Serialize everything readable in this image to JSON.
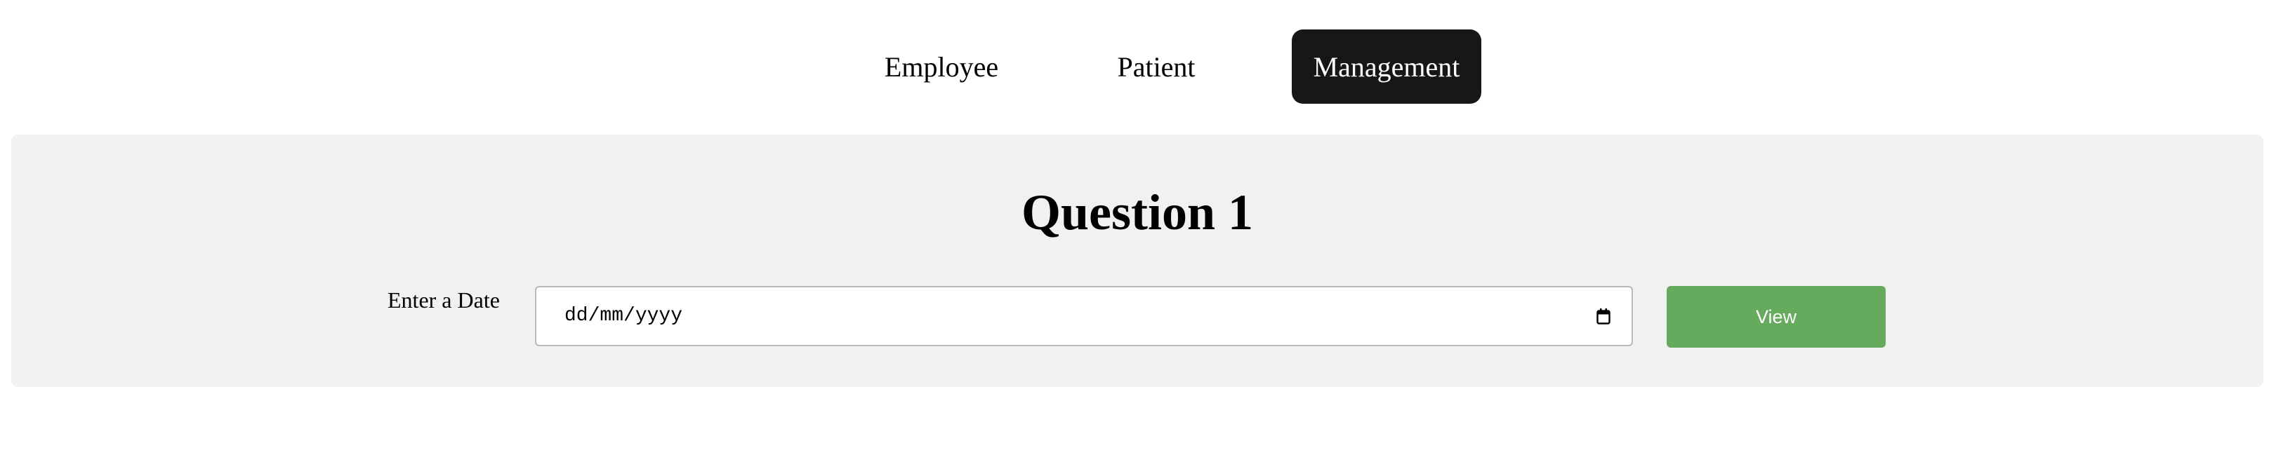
{
  "nav": {
    "items": [
      {
        "label": "Employee",
        "active": false
      },
      {
        "label": "Patient",
        "active": false
      },
      {
        "label": "Management",
        "active": true
      }
    ]
  },
  "question": {
    "title": "Question 1",
    "date_label": "Enter a Date",
    "date_input": {
      "placeholder": "dd/mm/yyyy",
      "value": "",
      "icon": "calendar-icon"
    },
    "view_button_label": "View"
  },
  "colors": {
    "active_tab_bg": "#171717",
    "panel_bg": "#f1f1f1",
    "view_button_bg": "#66ab5d"
  }
}
